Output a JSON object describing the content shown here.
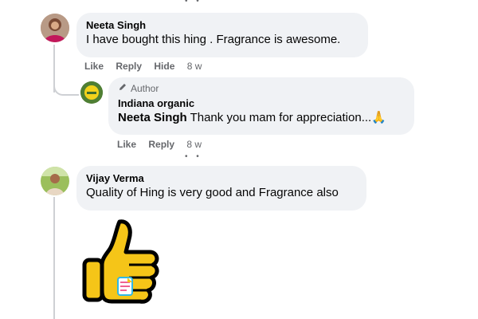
{
  "comments": [
    {
      "author": "Neeta Singh",
      "text": "I have bought this hing . Fragrance is awesome.",
      "actions": {
        "like": "Like",
        "reply": "Reply",
        "hide": "Hide",
        "time": "8 w"
      }
    },
    {
      "badge": "Author",
      "author": "Indiana organic",
      "mention": "Neeta Singh",
      "text": " Thank you mam for appreciation...🙏",
      "actions": {
        "like": "Like",
        "reply": "Reply",
        "time": "8 w"
      }
    },
    {
      "author": "Vijay Verma",
      "text": "Quality of Hing is very good and Fragrance also",
      "sticker": "thumbs-up"
    }
  ],
  "colors": {
    "bubble": "#f0f2f5",
    "secondary_text": "#65676b",
    "thread_line": "#ced0d4",
    "thumb_fill": "#f5c518"
  }
}
